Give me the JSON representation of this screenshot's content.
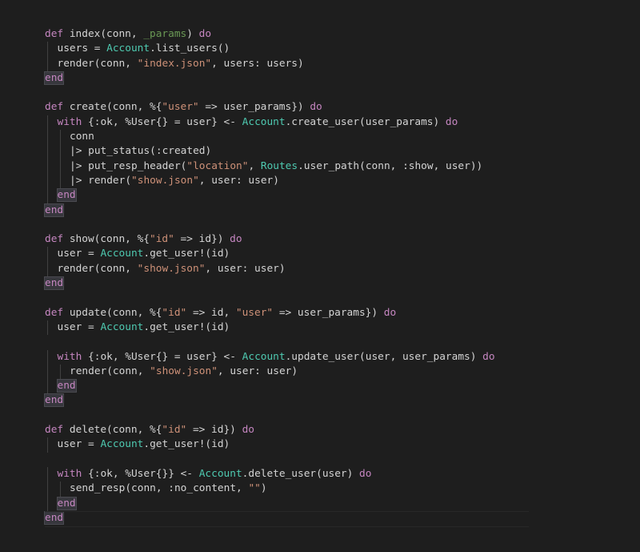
{
  "editor": {
    "colors": {
      "background": "#1e1e1e",
      "keyword": "#c586c0",
      "module": "#4ec9b0",
      "string": "#ce9178",
      "default": "#d4d4d4",
      "unused": "#6a9955"
    },
    "lines": [
      {
        "indent": 0,
        "tokens": [
          {
            "t": "def",
            "c": "keyword"
          },
          {
            "t": " index(conn, "
          },
          {
            "t": "_params",
            "c": "unused"
          },
          {
            "t": ") "
          },
          {
            "t": "do",
            "c": "keyword"
          }
        ]
      },
      {
        "indent": 1,
        "tokens": [
          {
            "t": "users = "
          },
          {
            "t": "Account",
            "c": "module"
          },
          {
            "t": ".list_users()"
          }
        ]
      },
      {
        "indent": 1,
        "tokens": [
          {
            "t": "render(conn, "
          },
          {
            "t": "\"index.json\"",
            "c": "string"
          },
          {
            "t": ", users: users)"
          }
        ]
      },
      {
        "indent": 0,
        "tokens": [
          {
            "t": "end",
            "c": "keyword",
            "hl": true
          }
        ]
      },
      {
        "indent": 0,
        "tokens": []
      },
      {
        "indent": 0,
        "tokens": [
          {
            "t": "def",
            "c": "keyword"
          },
          {
            "t": " create(conn, %{"
          },
          {
            "t": "\"user\"",
            "c": "string"
          },
          {
            "t": " => user_params}) "
          },
          {
            "t": "do",
            "c": "keyword"
          }
        ]
      },
      {
        "indent": 1,
        "tokens": [
          {
            "t": "with",
            "c": "keyword"
          },
          {
            "t": " {:ok, %User{} = user} <- "
          },
          {
            "t": "Account",
            "c": "module"
          },
          {
            "t": ".create_user(user_params) "
          },
          {
            "t": "do",
            "c": "keyword"
          }
        ]
      },
      {
        "indent": 2,
        "tokens": [
          {
            "t": "conn"
          }
        ]
      },
      {
        "indent": 2,
        "tokens": [
          {
            "t": "|> put_status(:created)"
          }
        ]
      },
      {
        "indent": 2,
        "tokens": [
          {
            "t": "|> put_resp_header("
          },
          {
            "t": "\"location\"",
            "c": "string"
          },
          {
            "t": ", "
          },
          {
            "t": "Routes",
            "c": "module"
          },
          {
            "t": ".user_path(conn, :show, user))"
          }
        ]
      },
      {
        "indent": 2,
        "tokens": [
          {
            "t": "|> render("
          },
          {
            "t": "\"show.json\"",
            "c": "string"
          },
          {
            "t": ", user: user)"
          }
        ]
      },
      {
        "indent": 1,
        "tokens": [
          {
            "t": "end",
            "c": "keyword",
            "hl": true
          }
        ]
      },
      {
        "indent": 0,
        "tokens": [
          {
            "t": "end",
            "c": "keyword",
            "hl": true
          }
        ]
      },
      {
        "indent": 0,
        "tokens": []
      },
      {
        "indent": 0,
        "tokens": [
          {
            "t": "def",
            "c": "keyword"
          },
          {
            "t": " show(conn, %{"
          },
          {
            "t": "\"id\"",
            "c": "string"
          },
          {
            "t": " => id}) "
          },
          {
            "t": "do",
            "c": "keyword"
          }
        ]
      },
      {
        "indent": 1,
        "tokens": [
          {
            "t": "user = "
          },
          {
            "t": "Account",
            "c": "module"
          },
          {
            "t": ".get_user!(id)"
          }
        ]
      },
      {
        "indent": 1,
        "tokens": [
          {
            "t": "render(conn, "
          },
          {
            "t": "\"show.json\"",
            "c": "string"
          },
          {
            "t": ", user: user)"
          }
        ]
      },
      {
        "indent": 0,
        "tokens": [
          {
            "t": "end",
            "c": "keyword",
            "hl": true
          }
        ]
      },
      {
        "indent": 0,
        "tokens": []
      },
      {
        "indent": 0,
        "tokens": [
          {
            "t": "def",
            "c": "keyword"
          },
          {
            "t": " update(conn, %{"
          },
          {
            "t": "\"id\"",
            "c": "string"
          },
          {
            "t": " => id, "
          },
          {
            "t": "\"user\"",
            "c": "string"
          },
          {
            "t": " => user_params}) "
          },
          {
            "t": "do",
            "c": "keyword"
          }
        ]
      },
      {
        "indent": 1,
        "tokens": [
          {
            "t": "user = "
          },
          {
            "t": "Account",
            "c": "module"
          },
          {
            "t": ".get_user!(id)"
          }
        ]
      },
      {
        "indent": 0,
        "tokens": []
      },
      {
        "indent": 1,
        "tokens": [
          {
            "t": "with",
            "c": "keyword"
          },
          {
            "t": " {:ok, %User{} = user} <- "
          },
          {
            "t": "Account",
            "c": "module"
          },
          {
            "t": ".update_user(user, user_params) "
          },
          {
            "t": "do",
            "c": "keyword"
          }
        ]
      },
      {
        "indent": 2,
        "tokens": [
          {
            "t": "render(conn, "
          },
          {
            "t": "\"show.json\"",
            "c": "string"
          },
          {
            "t": ", user: user)"
          }
        ]
      },
      {
        "indent": 1,
        "tokens": [
          {
            "t": "end",
            "c": "keyword",
            "hl": true
          }
        ]
      },
      {
        "indent": 0,
        "tokens": [
          {
            "t": "end",
            "c": "keyword",
            "hl": true
          }
        ]
      },
      {
        "indent": 0,
        "tokens": []
      },
      {
        "indent": 0,
        "tokens": [
          {
            "t": "def",
            "c": "keyword"
          },
          {
            "t": " delete(conn, %{"
          },
          {
            "t": "\"id\"",
            "c": "string"
          },
          {
            "t": " => id}) "
          },
          {
            "t": "do",
            "c": "keyword"
          }
        ]
      },
      {
        "indent": 1,
        "tokens": [
          {
            "t": "user = "
          },
          {
            "t": "Account",
            "c": "module"
          },
          {
            "t": ".get_user!(id)"
          }
        ]
      },
      {
        "indent": 0,
        "tokens": []
      },
      {
        "indent": 1,
        "tokens": [
          {
            "t": "with",
            "c": "keyword"
          },
          {
            "t": " {:ok, %User{}} <- "
          },
          {
            "t": "Account",
            "c": "module"
          },
          {
            "t": ".delete_user(user) "
          },
          {
            "t": "do",
            "c": "keyword"
          }
        ]
      },
      {
        "indent": 2,
        "tokens": [
          {
            "t": "send_resp(conn, :no_content, "
          },
          {
            "t": "\"\"",
            "c": "string"
          },
          {
            "t": ")"
          }
        ]
      },
      {
        "indent": 1,
        "tokens": [
          {
            "t": "end",
            "c": "keyword",
            "hl": true
          }
        ]
      },
      {
        "indent": 0,
        "tokens": [
          {
            "t": "end",
            "c": "keyword",
            "hl": true
          }
        ],
        "current": true
      }
    ]
  }
}
